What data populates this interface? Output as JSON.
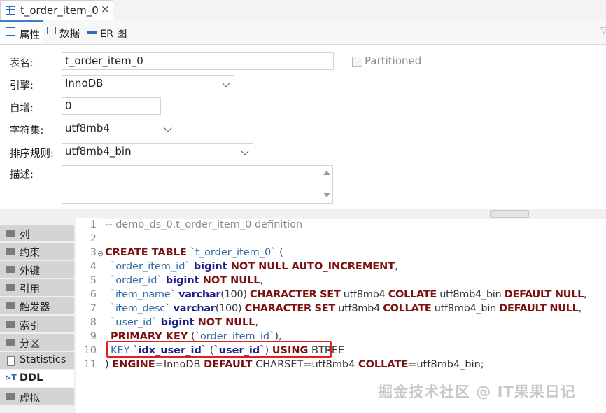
{
  "tab": {
    "title": "t_order_item_0",
    "close": "×"
  },
  "subtabs": [
    {
      "label": "属性"
    },
    {
      "label": "数据"
    },
    {
      "label": "ER 图"
    }
  ],
  "form": {
    "table_name_label": "表名:",
    "table_name": "t_order_item_0",
    "partitioned_label": "Partitioned",
    "engine_label": "引擎:",
    "engine": "InnoDB",
    "auto_inc_label": "自增:",
    "auto_inc": "0",
    "charset_label": "字符集:",
    "charset": "utf8mb4",
    "collation_label": "排序规则:",
    "collation": "utf8mb4_bin",
    "desc_label": "描述:",
    "desc": ""
  },
  "nav": [
    {
      "label": "列"
    },
    {
      "label": "约束"
    },
    {
      "label": "外键"
    },
    {
      "label": "引用"
    },
    {
      "label": "触发器"
    },
    {
      "label": "索引"
    },
    {
      "label": "分区"
    },
    {
      "label": "Statistics"
    },
    {
      "label": "DDL"
    },
    {
      "label": "虚拟"
    }
  ],
  "code": {
    "line_numbers": [
      "1",
      "2",
      "3",
      "4",
      "5",
      "6",
      "7",
      "8",
      "9",
      "10",
      "11"
    ],
    "l1": "-- demo_ds_0.t_order_item_0 definition",
    "l3": {
      "kw": "CREATE TABLE ",
      "id": "`t_order_item_0`",
      "rest": " ("
    },
    "l4": {
      "id": "`order_item_id`",
      "t1": " bigint",
      "kw": " NOT NULL AUTO_INCREMENT",
      "rest": ","
    },
    "l5": {
      "id": "`order_id`",
      "t1": " bigint",
      "kw": " NOT NULL",
      "rest": ","
    },
    "l6": {
      "id": "`item_name`",
      "t1": " varchar",
      "n": "(100) ",
      "k1": "CHARACTER SET",
      "p1": " utf8mb4 ",
      "k2": "COLLATE",
      "p2": " utf8mb4_bin ",
      "k3": "DEFAULT NULL",
      "rest": ","
    },
    "l7": {
      "id": "`item_desc`",
      "t1": " varchar",
      "n": "(100) ",
      "k1": "CHARACTER SET",
      "p1": " utf8mb4 ",
      "k2": "COLLATE",
      "p2": " utf8mb4_bin ",
      "k3": "DEFAULT NULL",
      "rest": ","
    },
    "l8": {
      "id": "`user_id`",
      "t1": " bigint",
      "kw": " NOT NULL",
      "rest": ","
    },
    "l9": {
      "kw": "PRIMARY KEY",
      "rest": " (",
      "id": "`order_item_id`",
      "end": "),"
    },
    "l10": {
      "kw": "KEY ",
      "id": "`idx_user_id`",
      "p": " (",
      "id2": "`user_id`",
      "p2": ") ",
      "kw2": "USING",
      "rest": " BTREE"
    },
    "l11": {
      "p": ") ",
      "k1": "ENGINE",
      "p1": "=InnoDB ",
      "k2": "DEFAULT",
      "p2": " CHARSET=utf8mb4 ",
      "k3": "COLLATE",
      "p3": "=utf8mb4_bin;"
    }
  },
  "watermark": "掘金技术社区 @ IT果果日记"
}
